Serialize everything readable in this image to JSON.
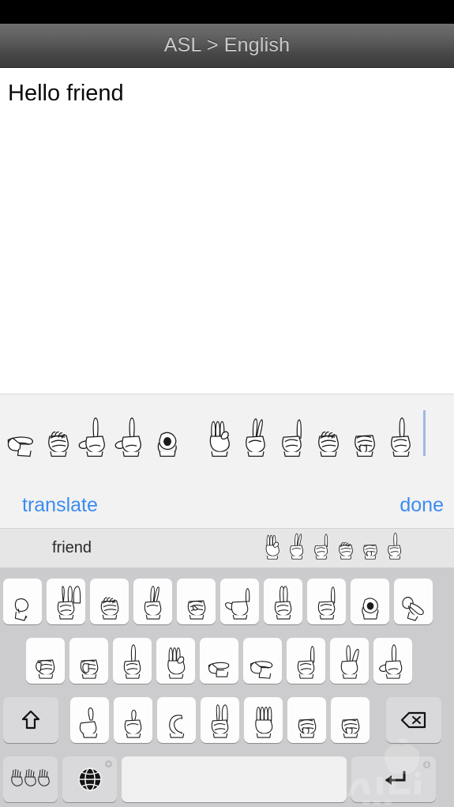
{
  "app": {
    "header": {
      "title": "ASL > English"
    },
    "document": {
      "text": "Hello friend"
    },
    "compose": {
      "typed_word": "Hello friend",
      "typed_letters": [
        "H",
        "E",
        "L",
        "L",
        "O",
        "F",
        "R",
        "I",
        "E",
        "N",
        "D"
      ],
      "caret_visible": true,
      "translate_label": "translate",
      "done_label": "done"
    },
    "suggestion_bar": {
      "word": "friend",
      "glyph_letters": [
        "F",
        "R",
        "I",
        "E",
        "N",
        "D"
      ]
    },
    "keyboard": {
      "row1": [
        "Q",
        "W",
        "E",
        "R",
        "T",
        "Y",
        "U",
        "I",
        "O",
        "P"
      ],
      "row2": [
        "A",
        "S",
        "D",
        "F",
        "G",
        "H",
        "J",
        "K",
        "L"
      ],
      "row3_letters": [
        "Z",
        "X",
        "C",
        "V",
        "B",
        "N",
        "M"
      ],
      "shift_icon": "shift-arrow-icon",
      "backspace_icon": "backspace-icon",
      "asl_mode_icon": "asl-hands-icon",
      "globe_icon": "globe-icon",
      "globe_badge_icon": "gear-badge-icon",
      "space_label": "",
      "return_icon": "return-arrow-icon",
      "return_badge_icon": "mic-badge-icon"
    },
    "colors": {
      "header_top": "#6f6f6f",
      "header_bottom": "#3a3a3a",
      "header_title": "#c9c9c9",
      "accent_blue": "#3c8cf0",
      "keyboard_bg": "#ccccce",
      "key_bg": "#fdfdfd",
      "fn_key_bg": "#d9d9dc",
      "suggest_bg": "#e6e6e6",
      "compose_bg": "#f2f2f2",
      "caret": "#9fb8e8"
    }
  }
}
